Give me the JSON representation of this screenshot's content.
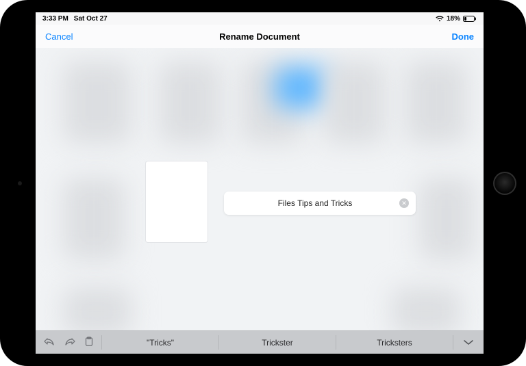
{
  "status": {
    "time": "3:33 PM",
    "date": "Sat Oct 27",
    "battery_pct": "18%"
  },
  "nav": {
    "cancel": "Cancel",
    "title": "Rename Document",
    "done": "Done"
  },
  "rename": {
    "value": "Files Tips and Tricks"
  },
  "quicktype": {
    "suggestions": [
      "\"Tricks\"",
      "Trickster",
      "Tricksters"
    ]
  }
}
